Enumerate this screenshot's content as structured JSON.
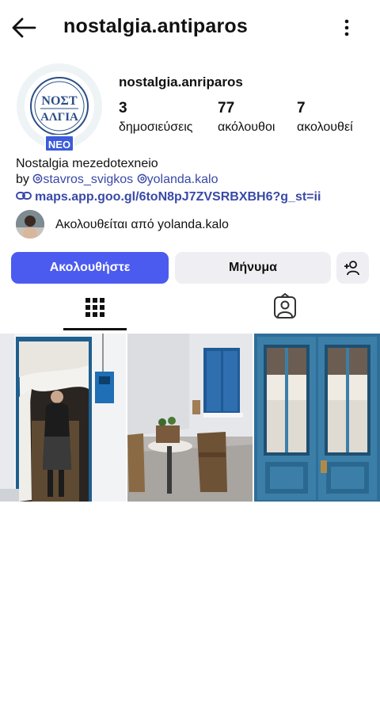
{
  "header": {
    "title": "nostalgia.antiparos"
  },
  "profile": {
    "avatar_logo_line1": "ΝΟΣΤ",
    "avatar_logo_line2": "ΑΛΓΙΑ",
    "new_badge": "ΝΕΟ",
    "username": "nostalgia.anriparos",
    "stats": [
      {
        "value": "3",
        "label": "δημοσιεύσεις"
      },
      {
        "value": "77",
        "label": "ακόλουθοι"
      },
      {
        "value": "7",
        "label": "ακολουθεί"
      }
    ]
  },
  "bio": {
    "name": "Nostalgia mezedotexneio",
    "by_prefix": "by ",
    "mention1": "stavros_svigkos",
    "mention2": "yolanda.kalo",
    "link": "maps.app.goo.gl/6toN8pJ7ZVSRBXBH6?g_st=ii"
  },
  "followed_by": {
    "prefix": "Ακολουθείται από ",
    "user": "yolanda.kalo"
  },
  "actions": {
    "follow": "Ακολουθήστε",
    "message": "Μήνυμα"
  },
  "icons": {
    "back": "arrow-left-icon",
    "menu": "more-vertical-icon",
    "add_user": "add-user-icon",
    "grid": "grid-icon",
    "tagged": "tagged-person-icon",
    "link": "link-icon",
    "threads": "threads-icon"
  },
  "colors": {
    "accent": "#4b5bf0",
    "link": "#3949a8",
    "badge": "#3b5bdb"
  }
}
